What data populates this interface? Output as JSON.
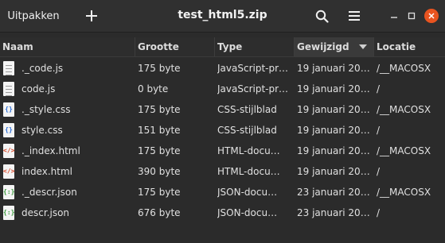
{
  "header": {
    "extract_label": "Uitpakken",
    "title": "test_html5.zip"
  },
  "columns": {
    "name": "Naam",
    "size": "Grootte",
    "type": "Type",
    "modified": "Gewijzigd",
    "location": "Locatie"
  },
  "files": [
    {
      "name": "._code.js",
      "size": "175 byte",
      "type": "JavaScript-pr…",
      "modified": "19 januari 20…",
      "location": "/__MACOSX",
      "icon": "text-file-icon",
      "glyph": ""
    },
    {
      "name": "code.js",
      "size": "0 byte",
      "type": "JavaScript-pr…",
      "modified": "19 januari 20…",
      "location": "/",
      "icon": "text-file-icon",
      "glyph": ""
    },
    {
      "name": "._style.css",
      "size": "175 byte",
      "type": "CSS-stijlblad",
      "modified": "19 januari 20…",
      "location": "/__MACOSX",
      "icon": "css-file-icon",
      "glyph": "{}"
    },
    {
      "name": "style.css",
      "size": "151 byte",
      "type": "CSS-stijlblad",
      "modified": "19 januari 20…",
      "location": "/",
      "icon": "css-file-icon",
      "glyph": "{}"
    },
    {
      "name": "._index.html",
      "size": "175 byte",
      "type": "HTML-docu…",
      "modified": "19 januari 20…",
      "location": "/__MACOSX",
      "icon": "html-file-icon",
      "glyph": "</>"
    },
    {
      "name": "index.html",
      "size": "390 byte",
      "type": "HTML-docu…",
      "modified": "19 januari 20…",
      "location": "/",
      "icon": "html-file-icon",
      "glyph": "</>"
    },
    {
      "name": "._descr.json",
      "size": "175 byte",
      "type": "JSON-docu…",
      "modified": "23 januari 20…",
      "location": "/__MACOSX",
      "icon": "json-file-icon",
      "glyph": "{:}"
    },
    {
      "name": "descr.json",
      "size": "676 byte",
      "type": "JSON-docu…",
      "modified": "23 januari 20…",
      "location": "/",
      "icon": "json-file-icon",
      "glyph": "{:}"
    }
  ],
  "colors": {
    "background": "#2b2b2b",
    "headerbar": "#303030",
    "close_button": "#e95420",
    "html_icon": "#d94a2a",
    "css_icon": "#2f6fd6",
    "json_icon": "#3c9a3c"
  }
}
